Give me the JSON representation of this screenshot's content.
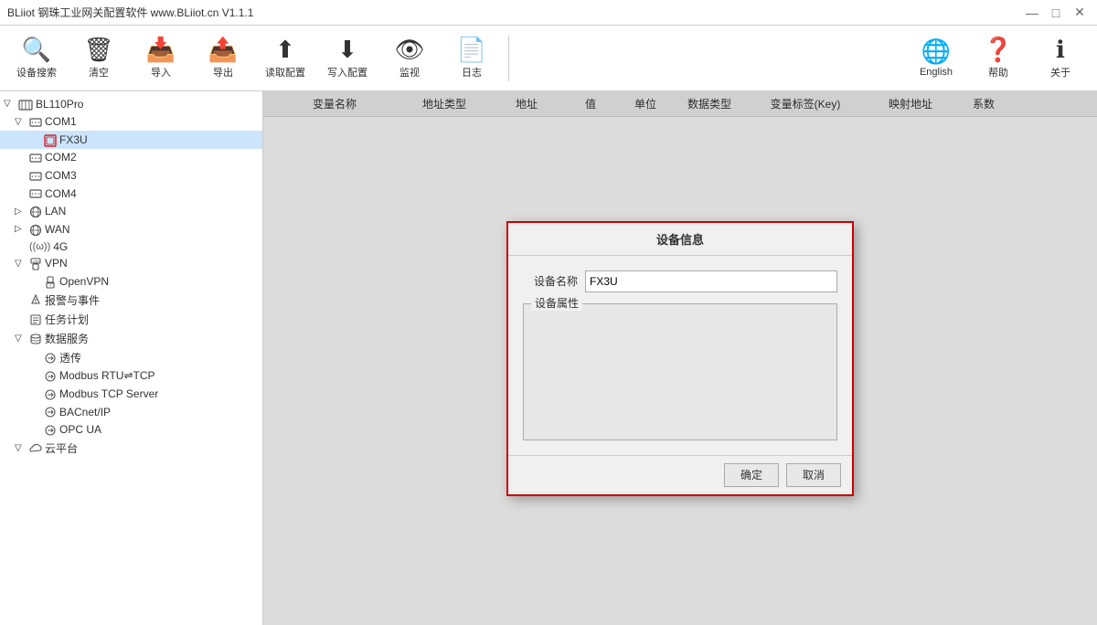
{
  "titlebar": {
    "title": "BLiiot 钢珠工业网关配置软件 www.BLiiot.cn V1.1.1",
    "min": "—",
    "max": "□",
    "close": "✕"
  },
  "toolbar": {
    "search_label": "设备搜索",
    "clear_label": "清空",
    "import_label": "导入",
    "export_label": "导出",
    "read_config_label": "读取配置",
    "write_config_label": "写入配置",
    "monitor_label": "监视",
    "log_label": "日志",
    "language_label": "English",
    "help_label": "帮助",
    "about_label": "关于"
  },
  "table": {
    "headers": [
      "变量名称",
      "地址类型",
      "地址",
      "值",
      "单位",
      "数据类型",
      "变量标签(Key)",
      "映射地址",
      "系数"
    ]
  },
  "sidebar": {
    "items": [
      {
        "id": "bl110pro",
        "label": "BL110Pro",
        "level": 0,
        "expandable": true,
        "expanded": true,
        "icon": "🖧"
      },
      {
        "id": "com1",
        "label": "COM1",
        "level": 1,
        "expandable": true,
        "expanded": true,
        "icon": "🔌"
      },
      {
        "id": "fx3u",
        "label": "FX3U",
        "level": 2,
        "expandable": false,
        "expanded": false,
        "icon": "📟",
        "selected": true
      },
      {
        "id": "com2",
        "label": "COM2",
        "level": 1,
        "expandable": false,
        "expanded": false,
        "icon": "🔌"
      },
      {
        "id": "com3",
        "label": "COM3",
        "level": 1,
        "expandable": false,
        "expanded": false,
        "icon": "🔌"
      },
      {
        "id": "com4",
        "label": "COM4",
        "level": 1,
        "expandable": false,
        "expanded": false,
        "icon": "🔌"
      },
      {
        "id": "lan",
        "label": "LAN",
        "level": 1,
        "expandable": true,
        "expanded": false,
        "icon": "🌐"
      },
      {
        "id": "wan",
        "label": "WAN",
        "level": 1,
        "expandable": true,
        "expanded": false,
        "icon": "🌐"
      },
      {
        "id": "4g",
        "label": "4G",
        "level": 1,
        "expandable": false,
        "expanded": false,
        "icon": "📶"
      },
      {
        "id": "vpn",
        "label": "VPN",
        "level": 1,
        "expandable": true,
        "expanded": true,
        "icon": "🔒"
      },
      {
        "id": "openvpn",
        "label": "OpenVPN",
        "level": 2,
        "expandable": false,
        "expanded": false,
        "icon": "🔒"
      },
      {
        "id": "alarm",
        "label": "报警与事件",
        "level": 1,
        "expandable": false,
        "expanded": false,
        "icon": "🔔"
      },
      {
        "id": "task",
        "label": "任务计划",
        "level": 1,
        "expandable": false,
        "expanded": false,
        "icon": "📋"
      },
      {
        "id": "dataservice",
        "label": "数据服务",
        "level": 1,
        "expandable": true,
        "expanded": true,
        "icon": "💾"
      },
      {
        "id": "transfer",
        "label": "透传",
        "level": 2,
        "expandable": false,
        "expanded": false,
        "icon": "🔄"
      },
      {
        "id": "modbus-rtu-tcp",
        "label": "Modbus RTU⇌TCP",
        "level": 2,
        "expandable": false,
        "expanded": false,
        "icon": "🔄"
      },
      {
        "id": "modbus-tcp-server",
        "label": "Modbus TCP Server",
        "level": 2,
        "expandable": false,
        "expanded": false,
        "icon": "🔄"
      },
      {
        "id": "bacnet",
        "label": "BACnet/IP",
        "level": 2,
        "expandable": false,
        "expanded": false,
        "icon": "🔄"
      },
      {
        "id": "opc-ua",
        "label": "OPC UA",
        "level": 2,
        "expandable": false,
        "expanded": false,
        "icon": "🔄"
      },
      {
        "id": "cloud",
        "label": "云平台",
        "level": 1,
        "expandable": true,
        "expanded": true,
        "icon": "☁"
      }
    ]
  },
  "dialog": {
    "title": "设备信息",
    "name_label": "设备名称",
    "name_value": "FX3U",
    "attrs_label": "设备属性",
    "confirm_label": "确定",
    "cancel_label": "取消"
  },
  "colors": {
    "accent": "#cc0000",
    "selected_bg": "#cce5ff",
    "toolbar_hover": "#e8f0fe"
  }
}
